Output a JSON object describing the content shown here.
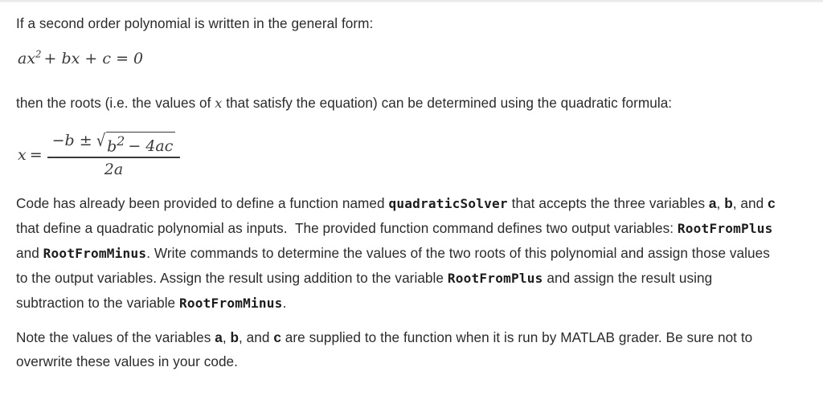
{
  "document": {
    "intro_line": "If a second order polynomial is written in the general form:",
    "general_form_equation": {
      "lhs_a": "ax",
      "exponent": "2",
      "rest": "+ bx + c = 0",
      "plain": "ax2 + bx + c = 0"
    },
    "roots_sentence": {
      "before_var": "then the roots (i.e. the values of ",
      "variable": "x",
      "after_var": " that satisfy the equation) can be determined using the quadratic formula:"
    },
    "quadratic_formula": {
      "lhs": "x",
      "equals": "=",
      "numerator_lead": "−b ±",
      "radical_glyph": "√",
      "radicand_base": "b",
      "radicand_exponent": "2",
      "radicand_rest": "− 4ac",
      "denominator": "2a",
      "plain": "x = (-b ± sqrt(b^2 - 4ac)) / (2a)"
    },
    "body_paragraph": {
      "seg1": "Code has already been provided to define a function named ",
      "code1": "quadraticSolver",
      "seg2": " that accepts the three variables ",
      "var_a": "a",
      "sep1": ", ",
      "var_b": "b",
      "sep2": ", and ",
      "var_c": "c",
      "seg3": "  that define a quadratic polynomial as inputs.  The provided function command defines two output variables: ",
      "code2": "RootFromPlus",
      "seg4": " and ",
      "code3": "RootFromMinus",
      "seg5": ". Write commands to determine the values of the two roots of this polynomial and assign those values to the output variables. Assign the result using addition to the variable ",
      "code4": "RootFromPlus",
      "seg6": " and assign the result using subtraction to the variable ",
      "code5": "RootFromMinus",
      "seg7": "."
    },
    "note_paragraph": {
      "seg1": "Note the values of the variables ",
      "var_a": "a",
      "sep1": ", ",
      "var_b": "b",
      "sep2": ", and ",
      "var_c": "c",
      "seg2": " are supplied to the function when it is run by MATLAB grader. Be sure not to overwrite these values in your code."
    }
  },
  "colors": {
    "text": "#2b2b2b",
    "code_text": "#1c1c1c",
    "math_text": "#3a3a3a",
    "divider": "#e9e9e9",
    "background": "#ffffff"
  }
}
